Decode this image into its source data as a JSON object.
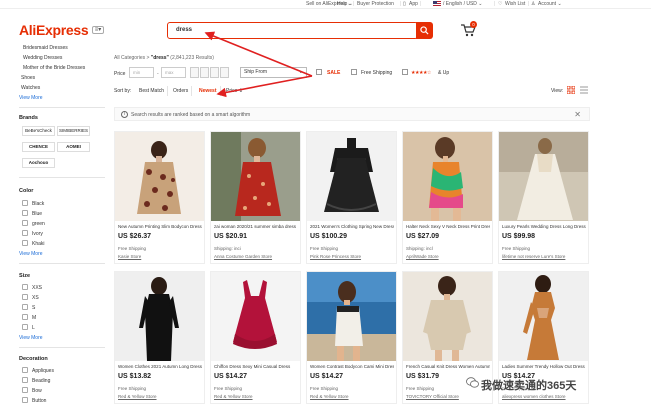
{
  "topbar": {
    "sell": "Sell on AliExpress ⌄",
    "help": "Help ⌄",
    "buyer_protection": "Buyer Protection",
    "app": "App",
    "lang": "/ English / USD ⌄",
    "wishlist": "Wish List",
    "account": "Account ⌄"
  },
  "header": {
    "logo": "AliExpress",
    "menu": "≡▾",
    "search_value": "dress",
    "cart_count": "0"
  },
  "sidebar": {
    "cat_links": [
      "Bridesmaid Dresses",
      "Wedding Dresses",
      "Mother of the Bride Dresses"
    ],
    "top_links": [
      "Shoes",
      "Watches"
    ],
    "view_more": "View More",
    "brands_title": "Brands",
    "brands": [
      "BeBe'sCheck",
      "SIMIBERRIES",
      "CHENCE",
      "AOMEI",
      "Aochouo"
    ],
    "color_title": "Color",
    "colors": [
      "Black",
      "Blue",
      "green",
      "Ivory",
      "Khaki"
    ],
    "size_title": "Size",
    "sizes": [
      "XXS",
      "XS",
      "S",
      "M",
      "L"
    ],
    "decoration_title": "Decoration",
    "decorations": [
      "Appliques",
      "Beading",
      "Bow",
      "Button"
    ]
  },
  "filters": {
    "crumb_prefix": "All Categories  >  ",
    "crumb_query": "\"dress\"",
    "crumb_count": " (2,841,223 Results)",
    "price_label": "Price",
    "min_placeholder": "min",
    "max_placeholder": "max",
    "ship_from": "Ship From",
    "sale": "SALE",
    "free_shipping": "Free Shipping",
    "stars": "★★★★☆",
    "rating_up": "& Up"
  },
  "sort": {
    "label": "Sort by:",
    "options": [
      "Best Match",
      "Orders",
      "Newest",
      "Price ⇕"
    ],
    "view_label": "View:"
  },
  "notice": {
    "text": "Search results are ranked based on a smart algorithm",
    "close": "✕"
  },
  "products": [
    {
      "title": "New Autumn Printing Slim Bodycon Dress",
      "price": "US $26.37",
      "ship": "Free Shipping",
      "store": "Kasie Store"
    },
    {
      "title": "zai woman 2020/21 summer simba dress",
      "price": "US $20.91",
      "ship": "Shipping: inci",
      "store": "Anna Costume Garden Store"
    },
    {
      "title": "2021 Women's Clothing Spring New Dress",
      "price": "US $100.29",
      "ship": "Free Shipping",
      "store": "Pink Rose Princess Store"
    },
    {
      "title": "Halter Neck Sexy V Neck Dress Print Dress",
      "price": "US $27.09",
      "ship": "Shipping: incl",
      "store": "AprilWade Store"
    },
    {
      "title": "Luxury Pearls Wedding Dress Long Dress",
      "price": "US $99.98",
      "ship": "Free Shipping",
      "store": "lifetime not reserve Lure's Store"
    },
    {
      "title": "Women Clothes 2021 Autumn Long Dress",
      "price": "US $13.82",
      "ship": "Free Shipping",
      "store": "Red & Yellow Store"
    },
    {
      "title": "Chiffon Dress Sexy Mini Casual Dress",
      "price": "US $14.27",
      "ship": "Free Shipping",
      "store": "Red & Yellow Store"
    },
    {
      "title": "Women Contrast Bodycon Cami Mini Dress",
      "price": "US $14.27",
      "ship": "Free Shipping",
      "store": "Red & Yellow Store"
    },
    {
      "title": "French Casual Knit Dress Women Autumn",
      "price": "US $31.79",
      "ship": "Free Shipping",
      "store": "TOVICTORY Official Store"
    },
    {
      "title": "Ladies Summer Trendy Hollow Out Dress",
      "price": "US $14.27",
      "ship": "Free Shipping",
      "store": "aliexpress women clothes Store"
    }
  ],
  "watermark": "我做速卖通的365天"
}
